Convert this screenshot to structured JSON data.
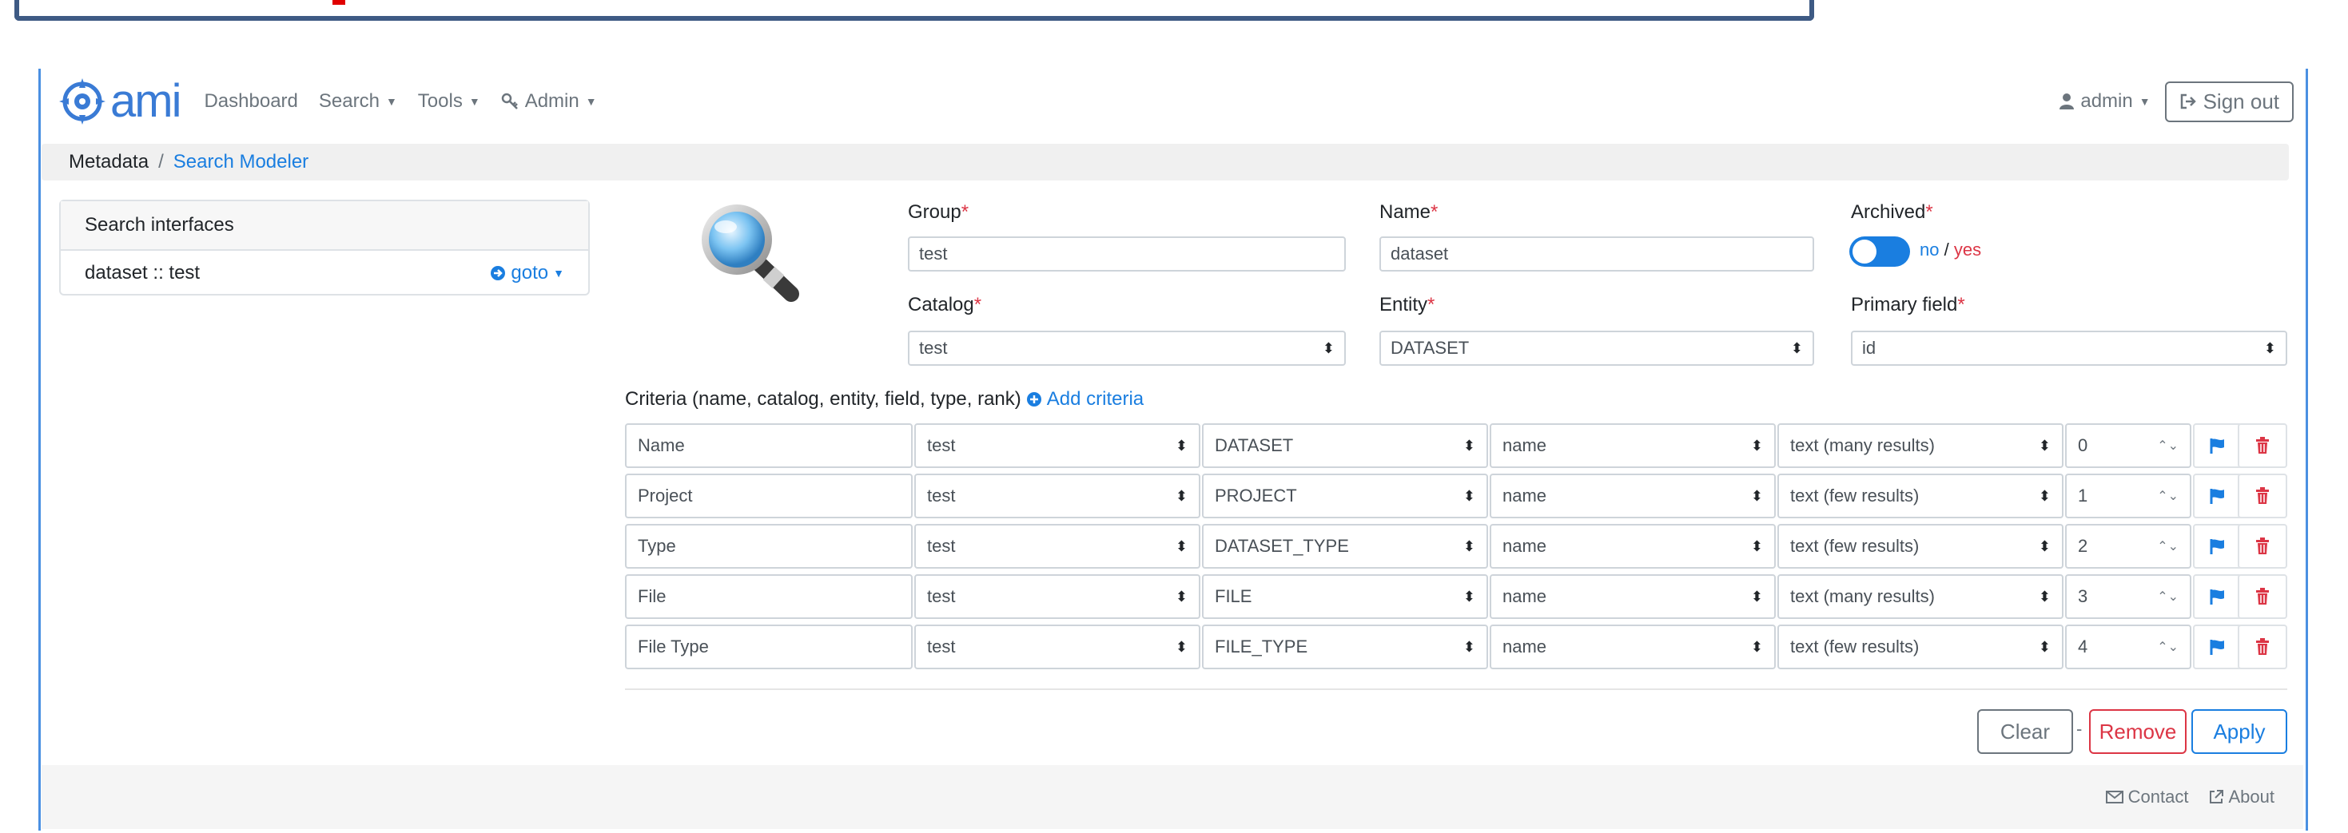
{
  "nav": {
    "logo_text": "ami",
    "items": [
      {
        "label": "Dashboard",
        "dropdown": false
      },
      {
        "label": "Search",
        "dropdown": true
      },
      {
        "label": "Tools",
        "dropdown": true
      },
      {
        "label": "Admin",
        "dropdown": true
      }
    ],
    "user_label": "admin",
    "sign_out_label": "Sign out"
  },
  "breadcrumb": {
    "root": "Metadata",
    "separator": "/",
    "current": "Search Modeler"
  },
  "sidebar": {
    "title": "Search interfaces",
    "items": [
      {
        "label": "dataset :: test",
        "goto_label": "goto"
      }
    ]
  },
  "form": {
    "group": {
      "label": "Group",
      "value": "test"
    },
    "name": {
      "label": "Name",
      "value": "dataset"
    },
    "archived": {
      "label": "Archived",
      "off_label": "no",
      "separator": "/",
      "on_label": "yes",
      "state": false
    },
    "catalog": {
      "label": "Catalog",
      "value": "test"
    },
    "entity": {
      "label": "Entity",
      "value": "DATASET"
    },
    "primary_field": {
      "label": "Primary field",
      "value": "id"
    },
    "required_marker": "*"
  },
  "criteria": {
    "header": "Criteria (name, catalog, entity, field, type, rank)",
    "add_label": "Add criteria",
    "rows": [
      {
        "name": "Name",
        "catalog": "test",
        "entity": "DATASET",
        "field": "name",
        "type": "text (many results)",
        "rank": "0"
      },
      {
        "name": "Project",
        "catalog": "test",
        "entity": "PROJECT",
        "field": "name",
        "type": "text (few results)",
        "rank": "1"
      },
      {
        "name": "Type",
        "catalog": "test",
        "entity": "DATASET_TYPE",
        "field": "name",
        "type": "text (few results)",
        "rank": "2"
      },
      {
        "name": "File",
        "catalog": "test",
        "entity": "FILE",
        "field": "name",
        "type": "text (many results)",
        "rank": "3"
      },
      {
        "name": "File Type",
        "catalog": "test",
        "entity": "FILE_TYPE",
        "field": "name",
        "type": "text (few results)",
        "rank": "4"
      }
    ]
  },
  "actions": {
    "clear": "Clear",
    "separator": "-",
    "remove": "Remove",
    "apply": "Apply"
  },
  "footer": {
    "contact": "Contact",
    "about": "About"
  },
  "colors": {
    "accent": "#1a7ee0",
    "danger": "#dc3545",
    "frame": "#4a90e2",
    "banner": "#3e5a84"
  }
}
